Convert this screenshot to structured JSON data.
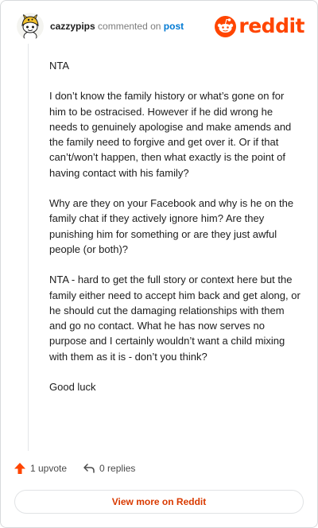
{
  "header": {
    "username": "cazzypips",
    "verb": "commented on",
    "post_link": "post"
  },
  "brand": {
    "wordmark": "reddit",
    "color": "#ff4500"
  },
  "comment": {
    "paragraphs": [
      "NTA",
      "I don’t know the family history or what’s gone on for him to be ostracised. However if he did wrong he needs to genuinely apologise and make amends and the family need to forgive and get over it. Or if that can’t/won’t happen, then what exactly is the point of having contact with his family?",
      "Why are they on your Facebook and why is he on the family chat if they actively ignore him? Are they punishing him for something or are they just awful people (or both)?",
      "NTA - hard to get the full story or context here but the family either need to accept him back and get along, or he should cut the damaging relationships with them and go no contact. What he has now serves no purpose and I certainly wouldn’t want a child mixing with them as it is - don’t you think?",
      "Good luck"
    ]
  },
  "actions": {
    "upvotes": "1 upvote",
    "replies": "0 replies",
    "upvote_icon": "upvote-arrow-icon",
    "reply_icon": "reply-arrow-icon"
  },
  "footer": {
    "view_more": "View more on Reddit"
  },
  "colors": {
    "accent": "#ff4500",
    "link": "#0079d3",
    "button_text": "#d93a00"
  }
}
